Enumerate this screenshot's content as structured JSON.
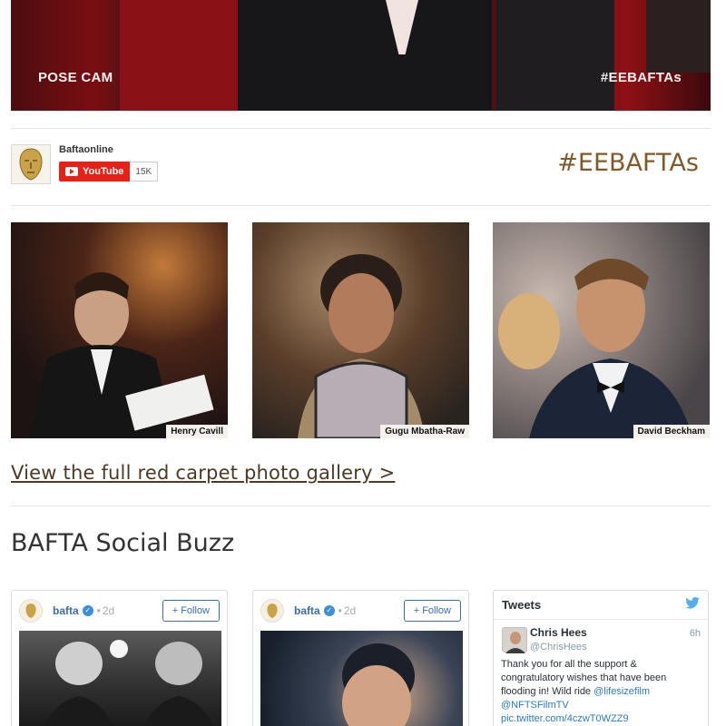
{
  "hero": {
    "caption_left": "POSE CAM",
    "caption_right": "#EEBAFTAs"
  },
  "channel": {
    "name": "Baftaonline",
    "youtube_label": "YouTube",
    "subscriber_count": "15K"
  },
  "hashtag": "#EEBAFTAs",
  "photos": [
    {
      "caption": "Henry Cavill"
    },
    {
      "caption": "Gugu Mbatha-Raw"
    },
    {
      "caption": "David Beckham"
    }
  ],
  "gallery_link": "View the full red carpet photo gallery >",
  "social_title": "BAFTA Social Buzz",
  "instagram": [
    {
      "user": "bafta",
      "dot": "•",
      "time": "2d",
      "follow": "+ Follow"
    },
    {
      "user": "bafta",
      "dot": "•",
      "time": "2d",
      "follow": "+ Follow"
    }
  ],
  "tweets": {
    "title": "Tweets",
    "item": {
      "name": "Chris Hees",
      "handle": "@ChrisHees",
      "time": "6h",
      "text_1": "Thank you for all the support & congratulatory wishes that have been flooding in! Wild ride",
      "link_1": "@lifesizefilm",
      "link_2": "@NFTSFilmTV",
      "link_3": "pic.twitter.com/4czwT0WZZ9"
    }
  },
  "colors": {
    "youtube_red": "#e62117",
    "hashtag_gold": "#7f5a2b",
    "link_blue": "#3a6ea5",
    "twitter_blue": "#55acee"
  }
}
